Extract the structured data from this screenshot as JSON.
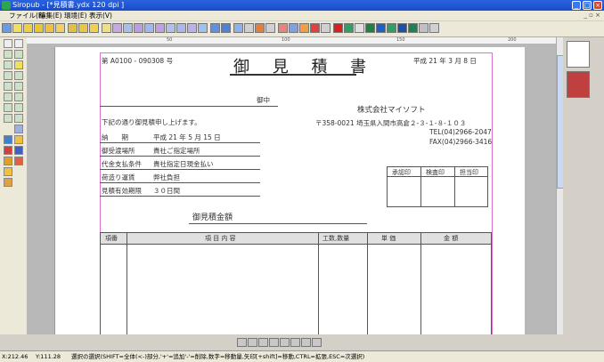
{
  "window": {
    "title": "Siropub - [*見積書.ydx  120 dpi ]"
  },
  "menu": [
    "ファイル(F)",
    "編集(E)",
    "環境(E)",
    "表示(V)"
  ],
  "ruler": [
    "50",
    "100",
    "150",
    "200"
  ],
  "doc": {
    "number": "第 A0100 - 090308 号",
    "title": "御 見 積 書",
    "date": "平成 21 年 3 月 8 日",
    "onchu": "御中",
    "company": "株式会社マイソフト",
    "address": "〒358-0021 埼玉県入間市高倉２-３-１-８-１０３",
    "tel": "TEL(04)2966-2047",
    "fax": "FAX(04)2966-3416",
    "intro": "下記の通り御見積申し上げます。",
    "fields": [
      {
        "label": "納　　期",
        "value": "平成 21 年 5 月 15 日"
      },
      {
        "label": "御受渡場所",
        "value": "貴社ご指定場所"
      },
      {
        "label": "代金支払条件",
        "value": "貴社指定日現金払い"
      },
      {
        "label": "荷造り運賃",
        "value": "弊社負担"
      },
      {
        "label": "見積有効期限",
        "value": "３０日間"
      }
    ],
    "stamps": [
      "承認印",
      "検査印",
      "担当印"
    ],
    "amount_label": "御見積金額",
    "columns": [
      "項番",
      "項 目 内 容",
      "工数,数量",
      "単 価",
      "金 額"
    ]
  },
  "status": {
    "x": "X:212.46",
    "y": "Y:111.28",
    "hint": "選択の選択(SHIFT=全体(<-)部分,'+'=追加'-'=削除,数字=移動量,矢印[+shift]=移動,CTRL=拡張,ESC=次選択)"
  }
}
